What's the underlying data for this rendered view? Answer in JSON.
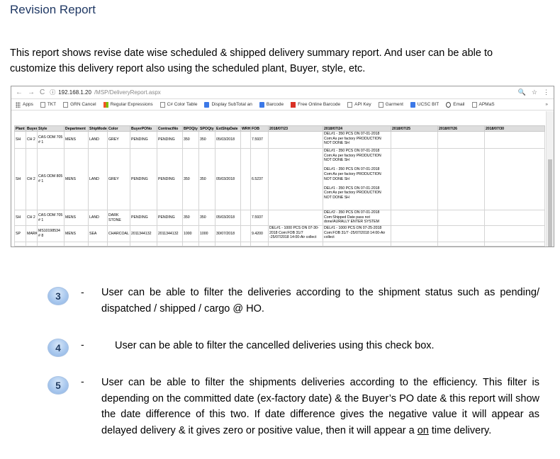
{
  "title": "Revision Report",
  "intro": "This report shows revise date wise scheduled & shipped delivery summary report. And user can be able to customize this delivery report also using the scheduled plant, Buyer, style, etc.",
  "browser": {
    "url_host": "192.168.1.20",
    "url_path": "/MSP/DeliveryReport.aspx",
    "bookmarks": [
      "Apps",
      "TKT",
      "GRN Cancel",
      "Regular Expressions",
      "C# Color Table",
      "Display SubTotal an",
      "Barcode",
      "Free Online Barcode",
      "API Key",
      "Garment",
      "UCSC BIT",
      "Email",
      "APMaS"
    ],
    "more": "»"
  },
  "table": {
    "headers": [
      "Plant",
      "Buyer",
      "Style",
      "Department",
      "ShipMode",
      "Color",
      "BuyerPONo",
      "ContractNo",
      "BPOQty",
      "SPOQty",
      "ExtShipDate",
      "WRH",
      "FOB",
      "2018/07/23",
      "2018/07/24",
      "2018/07/25",
      "2018/07/26",
      "2018/07/30"
    ],
    "rows": [
      [
        "SH",
        "CH 2",
        "CAS ODM 705 # 1",
        "MENS",
        "LAND",
        "GREY",
        "PENDING",
        "PENDING",
        "350",
        "350",
        "05/03/2018",
        "",
        "7.5937",
        "",
        "DEL#1 - 350 PCS ON 07-01-2018\nCom:As per factory PRODUCTION NOT DONE SH",
        "",
        "",
        ""
      ],
      [
        "SH",
        "CH 2",
        "CAS ODM 805 # 1",
        "MENS",
        "LAND",
        "GREY",
        "PENDING",
        "PENDING",
        "350",
        "350",
        "05/03/2018",
        "",
        "6.5237",
        "",
        "DEL#1 - 350 PCS ON 07-01-2018\nCom:As per factory PRODUCTION NOT DONE SH\n\nDEL#1 - 350 PCS ON 07-01-2018\nCom:As per factory PRODUCTION NOT DONE SH\n\nDEL#1 - 350 PCS ON 07-01-2018\nCom:As per factory PRODUCTION NOT DONE SH",
        "",
        "",
        ""
      ],
      [
        "SH",
        "CH 2",
        "CAS ODM 705 # 1",
        "MENS",
        "LAND",
        "DARK STONE",
        "PENDING",
        "PENDING",
        "350",
        "350",
        "05/03/2018",
        "",
        "7.5937",
        "",
        "DEL#2 - 350 PCS ON 07-01-2018\nCom:Shipped Date pass not done/AURALLY ENTER SYSTEM",
        "",
        "",
        ""
      ],
      [
        "SP",
        "MARK",
        "MS10198534 # 8",
        "MENS",
        "SEA",
        "CHARCOAL",
        "2011344132",
        "2011344132",
        "1000",
        "1000",
        "30/07/2018",
        "",
        "9.4200",
        "DEL#1 - 1000 PCS ON 07-30-2018 Com:FOB 31/7 -25/07/2018 14:00-Air collect",
        "DEL#1 - 1000 PCS ON 07-25-2018\nCom:FOB 31/7 -25/07/2018 14:00-Air collect",
        "",
        "",
        ""
      ]
    ]
  },
  "items": [
    {
      "num": "3",
      "dash": "-",
      "text": "User can be able to filter the deliveries according to the shipment status such as pending/ dispatched / shipped / cargo @ HO."
    },
    {
      "num": "4",
      "dash": "-",
      "text": "User can be able to filter the cancelled deliveries using this check box."
    },
    {
      "num": "5",
      "dash": "-",
      "text_a": "User can be able to filter the shipments deliveries according to the efficiency. This filter is depending on the committed date (ex-factory date) & the Buyer’s PO date & this report will show the date difference of this two. If date difference gives the negative value it will appear as delayed delivery & it gives zero or positive value, then it will appear a ",
      "text_u": "on",
      "text_b": " time delivery."
    }
  ]
}
